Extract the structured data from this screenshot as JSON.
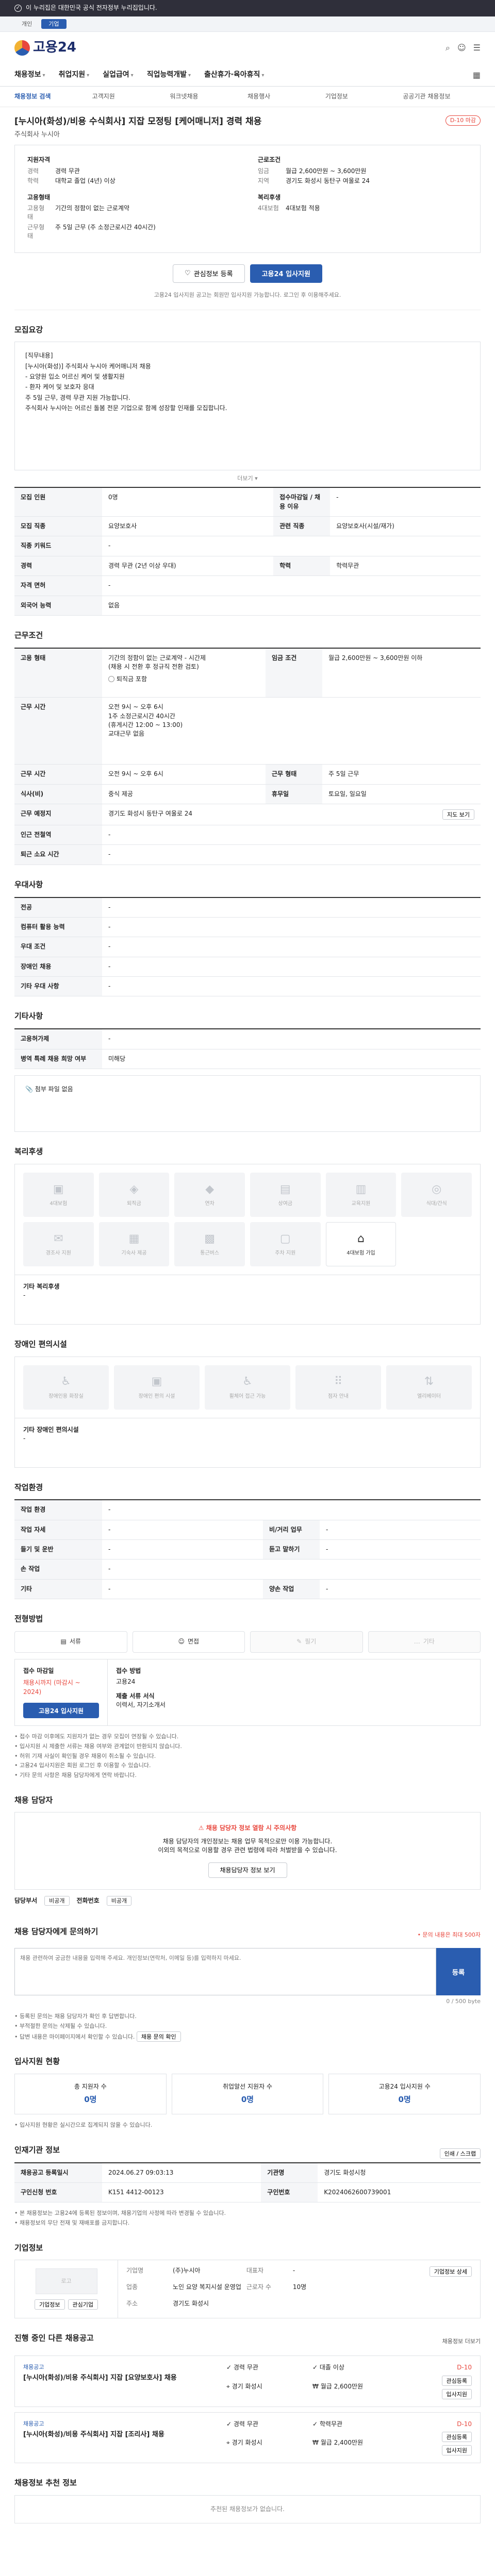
{
  "topbar": {
    "text": "이 누리집은 대한민국 공식 전자정부 누리집입니다."
  },
  "segments": [
    "개인",
    "기업"
  ],
  "logo": {
    "text": "고용24"
  },
  "gnb": [
    "채용정보",
    "취업지원",
    "실업급여",
    "직업능력개발",
    "출산휴가·육아휴직"
  ],
  "subnav": [
    "채용정보 검색",
    "고객지원",
    "워크넷채용",
    "채용행사",
    "기업정보",
    "공공기관 채용정보"
  ],
  "job": {
    "title": "[누시아(화성)/비용 수식회사] 지잡 모정팅 [케어매니저] 경력 채용",
    "company": "주식회사 누시아",
    "badge": "D-10 마감"
  },
  "summary": {
    "left": [
      {
        "h": "지원자격",
        "lines": [
          {
            "k": "경력",
            "v": "경력 무관"
          },
          {
            "k": "학력",
            "v": "대학교 졸업 (4년) 이상"
          }
        ]
      },
      {
        "h": "고용형태",
        "lines": [
          {
            "k": "고용형태",
            "v": "기간의 정함이 없는 근로계약"
          },
          {
            "k": "근무형태",
            "v": "주 5일 근무 (주 소정근로시간 40시간)"
          }
        ]
      }
    ],
    "right": [
      {
        "h": "근로조건",
        "lines": [
          {
            "k": "임금",
            "v": "월급 2,600만원 ~ 3,600만원"
          },
          {
            "k": "지역",
            "v": "경기도 화성시 동탄구 여울로 24"
          }
        ]
      },
      {
        "h": "복리후생",
        "lines": [
          {
            "k": "4대보험",
            "v": "4대보험 적용"
          }
        ]
      }
    ]
  },
  "buttons": {
    "save": "관심정보 등록",
    "apply": "고용24 입사지원"
  },
  "apply_note": "고용24 입사지원 공고는 회원만 입사지원 가능합니다. 로그인 후 이용해주세요.",
  "recruit": {
    "title": "모집요강",
    "body": [
      "[직무내용]",
      "[누시아(화성)] 주식회사 누시아 케어매니저 채용",
      "- 요양원 입소 어르신 케어 및 생활지원",
      "- 환자 케어 및 보호자 응대",
      "주 5일 근무, 경력 무관 지원 가능합니다.",
      "주식회사 누시아는 어르신 돌봄 전문 기업으로 함께 성장할 인재를 모집합니다."
    ],
    "more": "더보기",
    "rows": [
      [
        {
          "k": "모집 인원",
          "v": "0명"
        },
        {
          "k": "접수마감일 / 채용 이유",
          "v": "-"
        }
      ],
      [
        {
          "k": "모집 직종",
          "v": "요양보호사"
        },
        {
          "k": "관련 직종",
          "v": "요양보호사(시설/재가)"
        }
      ],
      [
        {
          "k": "직종 키워드",
          "v": "-"
        },
        {
          "k": "",
          "v": ""
        }
      ],
      [
        {
          "k": "경력",
          "v": "경력 무관 (2년 이상 우대)"
        },
        {
          "k": "학력",
          "v": "학력무관"
        }
      ],
      [
        {
          "k": "자격 면허",
          "v": "-"
        },
        {
          "k": "",
          "v": ""
        }
      ],
      [
        {
          "k": "외국어 능력",
          "v": "없음"
        },
        {
          "k": "",
          "v": ""
        }
      ]
    ]
  },
  "conditions": {
    "title": "근무조건",
    "employment": "기간의 정함이 없는 근로계약 - 시간제\n(채용 시 전환 후 정규직 전환 검토)",
    "wage_label": "임금 조건",
    "wage": "월급 2,600만원 ~ 3,600만원 이하",
    "insurance_note": "퇴직금 포함",
    "work_time": "오전 9시 ~ 오후 6시\n1주 소정근로시간 40시간\n(휴게시간 12:00 ~ 13:00)\n교대근무 없음",
    "rows": [
      [
        {
          "k": "근무 시간",
          "v": "오전 9시 ~ 오후 6시"
        },
        {
          "k": "근무 형태",
          "v": "주 5일 근무"
        }
      ],
      [
        {
          "k": "식사(비)",
          "v": "중식 제공"
        },
        {
          "k": "휴무일",
          "v": "토요일, 일요일"
        }
      ],
      [
        {
          "k": "근무 예정지",
          "v": "경기도 화성시 동탄구 여울로 24"
        },
        {
          "k": "",
          "v": ""
        }
      ],
      [
        {
          "k": "인근 전철역",
          "v": "-"
        },
        {
          "k": "",
          "v": ""
        }
      ],
      [
        {
          "k": "퇴근 소요 시간",
          "v": "-"
        },
        {
          "k": "",
          "v": ""
        }
      ]
    ],
    "map_button": "지도 보기"
  },
  "preference": {
    "title": "우대사항",
    "rows": [
      {
        "k": "전공",
        "v": "-"
      },
      {
        "k": "컴퓨터 활용 능력",
        "v": "-"
      },
      {
        "k": "우대 조건",
        "v": "-"
      },
      {
        "k": "장애인 채용",
        "v": "-"
      },
      {
        "k": "기타 우대 사항",
        "v": "-"
      }
    ]
  },
  "etc": {
    "title": "기타사항",
    "rows": [
      {
        "k": "고용허가제",
        "v": "-"
      },
      {
        "k": "병역 특례 채용 희망 여부",
        "v": "미해당"
      }
    ],
    "attach": "첨부 파일 없음"
  },
  "welfare": {
    "title": "복리후생",
    "icons": [
      {
        "name": "4대보험",
        "icon": "▣",
        "on": false
      },
      {
        "name": "퇴직금",
        "icon": "◈",
        "on": false
      },
      {
        "name": "연차",
        "icon": "◆",
        "on": false
      },
      {
        "name": "상여금",
        "icon": "▤",
        "on": false
      },
      {
        "name": "교육지원",
        "icon": "▥",
        "on": false
      },
      {
        "name": "식대/간식",
        "icon": "◎",
        "on": false
      },
      {
        "name": "경조사 지원",
        "icon": "✉",
        "on": false
      },
      {
        "name": "기숙사 제공",
        "icon": "▦",
        "on": false
      },
      {
        "name": "통근버스",
        "icon": "▩",
        "on": false
      },
      {
        "name": "주차 지원",
        "icon": "▢",
        "on": false
      },
      {
        "name": "4대보험 가입",
        "icon": "⌂",
        "on": true
      }
    ],
    "extra_label": "기타 복리후생",
    "extra": "-"
  },
  "disabled": {
    "title": "장애인 편의시설",
    "icons": [
      {
        "name": "장애인용 화장실"
      },
      {
        "name": "장애인 편의 시설"
      },
      {
        "name": "휠체어 접근 가능"
      },
      {
        "name": "점자 안내"
      },
      {
        "name": "엘리베이터"
      }
    ],
    "extra_label": "기타 장애인 편의시설",
    "extra": "-"
  },
  "workenv": {
    "title": "작업환경",
    "rows": [
      [
        {
          "k": "작업 환경",
          "v": "-"
        },
        {
          "k": "",
          "v": ""
        }
      ],
      [
        {
          "k": "작업 자세",
          "v": "-"
        },
        {
          "k": "비/거리 업무",
          "v": "-"
        }
      ],
      [
        {
          "k": "들기 및 운반",
          "v": "-"
        },
        {
          "k": "듣고 말하기",
          "v": "-"
        }
      ],
      [
        {
          "k": "손 작업",
          "v": "-"
        },
        {
          "k": "",
          "v": ""
        }
      ],
      [
        {
          "k": "기타",
          "v": "-"
        },
        {
          "k": "양손 작업",
          "v": "-"
        }
      ]
    ]
  },
  "method": {
    "title": "전형방법",
    "methods": [
      {
        "label": "서류",
        "on": true
      },
      {
        "label": "면접",
        "on": true
      },
      {
        "label": "필기",
        "on": false
      },
      {
        "label": "기타",
        "on": false
      }
    ],
    "deadline_label": "접수 마감일",
    "deadline": "채용시까지 (마감시 ~ 2024)",
    "apply_button": "고용24 입사지원",
    "form_label": "접수 방법",
    "form": "고용24",
    "docs_label": "제출 서류 서식",
    "docs": "이력서, 자기소개서",
    "notes": [
      "• 접수 마감 이후에도 지원자가 없는 경우 모집이 연장될 수 있습니다.",
      "• 입사지원 시 제출한 서류는 채용 여부와 관계없이 반환되지 않습니다.",
      "• 허위 기재 사실이 확인될 경우 채용이 취소될 수 있습니다.",
      "• 고용24 입사지원은 회원 로그인 후 이용할 수 있습니다.",
      "• 기타 문의 사항은 채용 담당자에게 연락 바랍니다."
    ]
  },
  "contact": {
    "title": "채용 담당자",
    "warn_title": "⚠ 채용 담당자 정보 열람 시 주의사항",
    "warn_lines": [
      "채용 담당자의 개인정보는 채용 업무 목적으로만 이용 가능합니다.",
      "이외의 목적으로 이용할 경우 관련 법령에 따라 처벌받을 수 있습니다."
    ],
    "view_button": "채용담당자 정보 보기",
    "dept_label": "담당부서",
    "dept": "비공개",
    "phone_label": "전화번호",
    "phone": "비공개"
  },
  "inquiry": {
    "title": "채용 담당자에게 문의하기",
    "guide": "• 문의 내용은 최대 500자",
    "placeholder": "채용 관련하여 궁금한 내용을 입력해 주세요. 개인정보(연락처, 이메일 등)를 입력하지 마세요.",
    "count": "0 / 500 byte",
    "send": "등록",
    "notes": [
      "• 등록된 문의는 채용 담당자가 확인 후 답변합니다.",
      "• 부적절한 문의는 삭제될 수 있습니다.",
      "• 답변 내용은 마이페이지에서 확인할 수 있습니다."
    ],
    "inquiry_button": "채용 문의 확인"
  },
  "status": {
    "title": "입사지원 현황",
    "cards": [
      {
        "label": "총 지원자 수",
        "value": "0명"
      },
      {
        "label": "취업알선 지원자 수",
        "value": "0명"
      },
      {
        "label": "고용24 입사지원 수",
        "value": "0명"
      }
    ],
    "note": "• 입사지원 현황은 실시간으로 집계되지 않을 수 있습니다."
  },
  "info": {
    "title": "인재기관 정보",
    "print": "인쇄 / 스크랩",
    "rows": [
      [
        {
          "k": "채용공고 등록일시",
          "v": "2024.06.27 09:03:13"
        },
        {
          "k": "기관명",
          "v": "경기도 화성시청"
        }
      ],
      [
        {
          "k": "구인신청 번호",
          "v": "K151 4412-00123"
        },
        {
          "k": "구인번호",
          "v": "K2024062600739001"
        }
      ]
    ],
    "notes": [
      "• 본 채용정보는 고용24에 등록된 정보이며, 채용기업의 사정에 따라 변경될 수 있습니다.",
      "• 채용정보의 무단 전재 및 재배포를 금지합니다."
    ]
  },
  "corp": {
    "title": "기업정보",
    "logo_label": "로고",
    "btn1": "기업정보",
    "btn2": "관심기업",
    "rows": [
      {
        "k": "기업명",
        "v": "(주)누시아"
      },
      {
        "k": "업종",
        "v": "노인 요양 복지시설 운영업"
      },
      {
        "k": "근로자 수",
        "v": "10명"
      },
      {
        "k": "대표자",
        "v": "-"
      },
      {
        "k": "주소",
        "v": "경기도 화성시"
      }
    ],
    "detail_btn": "기업정보 상세"
  },
  "other_jobs": {
    "title": "진행 중인 다른 채용공고",
    "badge": "채용정보 더보기",
    "items": [
      {
        "tag": "채용공고",
        "title": "[누시아(화성)/비용 주식회사] 지잡 [요양보호사] 채용",
        "l1": "경력 무관",
        "l2": "대졸 이상",
        "l3": "경기 화성시",
        "l4": "월급 2,600만원",
        "dday": "D-10",
        "btn1": "관심등록",
        "btn2": "입사지원"
      },
      {
        "tag": "채용공고",
        "title": "[누시아(화성)/비용 주식회사] 지잡 [조리사] 채용",
        "l1": "경력 무관",
        "l2": "학력무관",
        "l3": "경기 화성시",
        "l4": "월급 2,400만원",
        "dday": "D-10",
        "btn1": "관심등록",
        "btn2": "입사지원"
      }
    ]
  },
  "similar": {
    "title": "채용정보 추천 정보",
    "empty": "추천된 채용정보가 없습니다."
  }
}
